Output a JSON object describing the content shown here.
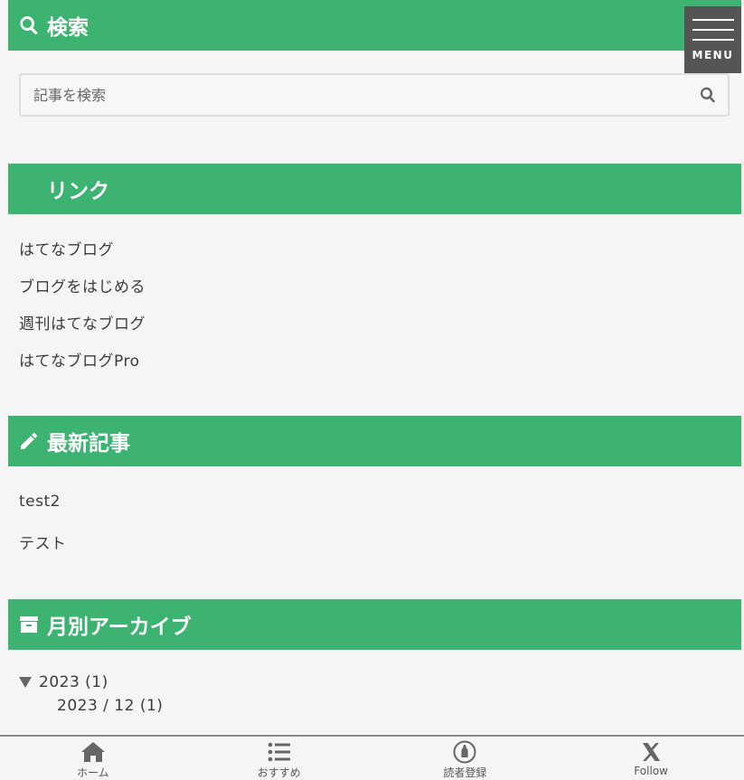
{
  "menu": {
    "label": "MENU"
  },
  "search": {
    "title": "検索",
    "placeholder": "記事を検索"
  },
  "links": {
    "title": "リンク",
    "items": [
      "はてなブログ",
      "ブログをはじめる",
      "週刊はてなブログ",
      "はてなブログPro"
    ]
  },
  "recent": {
    "title": "最新記事",
    "items": [
      "test2",
      "テスト"
    ]
  },
  "archive": {
    "title": "月別アーカイブ",
    "year": "2023 (1)",
    "month": "2023 / 12 (1)"
  },
  "bottom_nav": {
    "items": [
      {
        "label": "ホーム",
        "icon": "home-icon"
      },
      {
        "label": "おすすめ",
        "icon": "list-icon"
      },
      {
        "label": "読者登録",
        "icon": "subscribe-icon"
      },
      {
        "label": "Follow",
        "icon": "x-icon"
      }
    ]
  },
  "colors": {
    "accent": "#3cb371",
    "background": "#f5f5f5",
    "menu_bg": "#555555",
    "text": "#3c3c3c"
  }
}
